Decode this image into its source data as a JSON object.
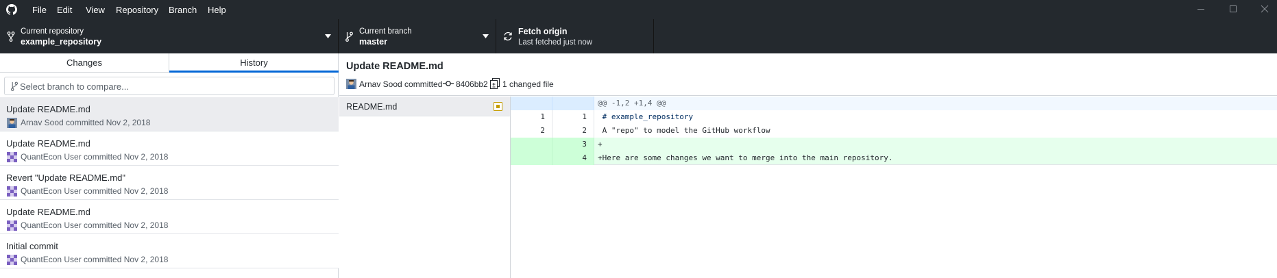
{
  "menu": [
    "File",
    "Edit",
    "View",
    "Repository",
    "Branch",
    "Help"
  ],
  "toolbar": {
    "repo_label": "Current repository",
    "repo_name": "example_repository",
    "branch_label": "Current branch",
    "branch_name": "master",
    "fetch_title": "Fetch origin",
    "fetch_status": "Last fetched just now"
  },
  "tabs": {
    "changes": "Changes",
    "history": "History",
    "active": "History"
  },
  "compare": {
    "placeholder": "Select branch to compare..."
  },
  "commits": [
    {
      "title": "Update README.md",
      "meta": "Arnav Sood committed Nov 2, 2018",
      "selected": true
    },
    {
      "title": "Update README.md",
      "meta": "QuantEcon User committed Nov 2, 2018"
    },
    {
      "title": "Revert \"Update README.md\"",
      "meta": "QuantEcon User committed Nov 2, 2018"
    },
    {
      "title": "Update README.md",
      "meta": "QuantEcon User committed Nov 2, 2018"
    },
    {
      "title": "Initial commit",
      "meta": "QuantEcon User committed Nov 2, 2018"
    }
  ],
  "commit_detail": {
    "title": "Update README.md",
    "author_line": "Arnav Sood committed",
    "sha": "8406bb2",
    "files_changed": "1 changed file"
  },
  "files": [
    {
      "name": "README.md",
      "status": "modified"
    }
  ],
  "diff": {
    "hunk_header": "@@ -1,2 +1,4 @@",
    "lines": [
      {
        "old": "1",
        "new": "1",
        "text": " # example_repository",
        "type": "context"
      },
      {
        "old": "2",
        "new": "2",
        "text": " A \"repo\" to model the GitHub workflow",
        "type": "context"
      },
      {
        "old": "",
        "new": "3",
        "text": "+",
        "type": "added"
      },
      {
        "old": "",
        "new": "4",
        "text": "+Here are some changes we want to merge into the main repository.",
        "type": "added"
      }
    ]
  },
  "colors": {
    "chrome": "#24292e",
    "accent": "#0366d6",
    "added_bg": "#e6ffed",
    "hunk_bg": "#f1f8ff",
    "modified": "#c59d00"
  },
  "icons": {
    "app": "github-logo-icon",
    "repo": "repo-fork-icon",
    "branch": "git-branch-icon",
    "fetch": "sync-icon",
    "commit": "git-commit-icon",
    "files": "diff-icon",
    "status": "file-modified-icon"
  }
}
